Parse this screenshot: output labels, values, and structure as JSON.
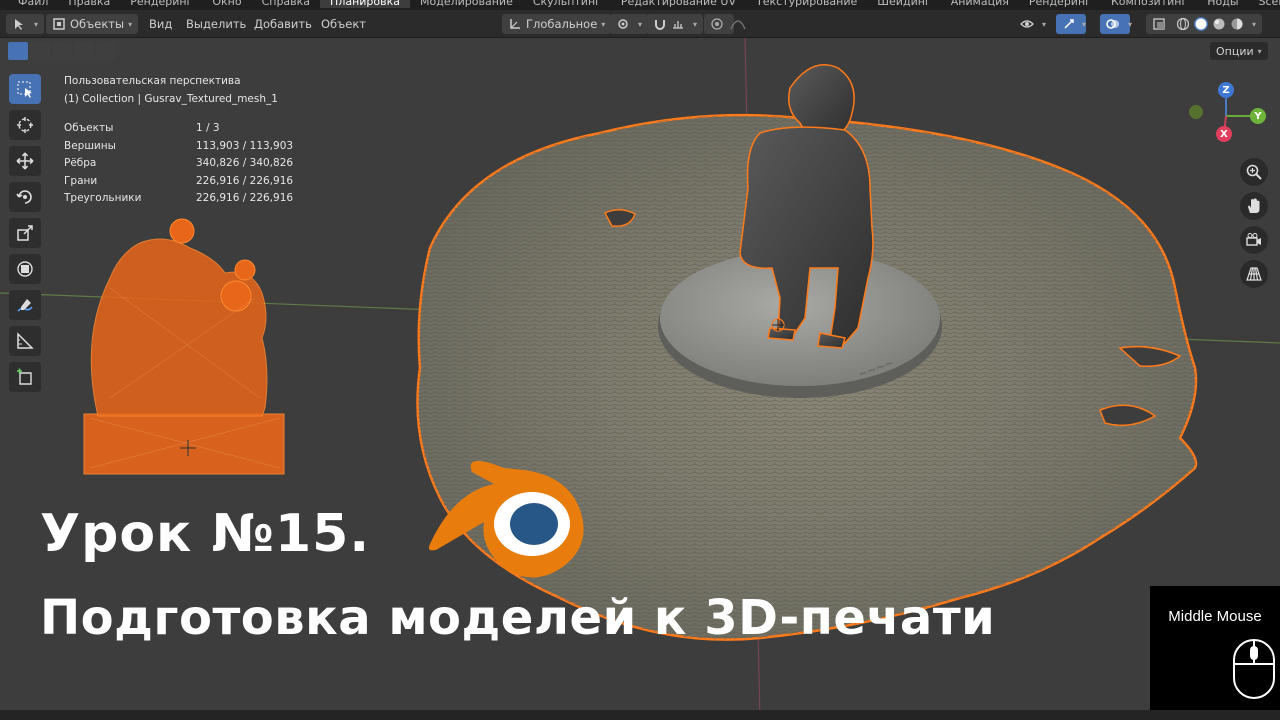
{
  "menu": {
    "items": [
      "Файл",
      "Правка",
      "Рендеринг",
      "Окно",
      "Справка",
      "Планировка",
      "Моделирование",
      "Скульптинг",
      "Редактирование UV",
      "Текстурирование",
      "Шейдинг",
      "Анимация",
      "Рендеринг",
      "Композитинг",
      "Ноды",
      "Scene"
    ],
    "active_index": 5
  },
  "toolbar": {
    "mode": "Объекты",
    "view": "Вид",
    "select": "Выделить",
    "add": "Добавить",
    "object": "Объект",
    "orientation": "Глобальное"
  },
  "viewport": {
    "options": "Опции",
    "perspective": "Пользовательская перспектива",
    "collection": "(1) Collection | Gusrav_Textured_mesh_1",
    "stats": [
      {
        "label": "Объекты",
        "value": "1 / 3"
      },
      {
        "label": "Вершины",
        "value": "113,903 / 113,903"
      },
      {
        "label": "Рёбра",
        "value": "340,826 / 340,826"
      },
      {
        "label": "Грани",
        "value": "226,916 / 226,916"
      },
      {
        "label": "Треугольники",
        "value": "226,916 / 226,916"
      }
    ],
    "gizmo": {
      "x": "X",
      "y": "Y",
      "z": "Z"
    }
  },
  "overlay": {
    "lesson": "Урок №15.",
    "subtitle": "Подготовка моделей к 3D-печати",
    "key_hint": "Middle Mouse"
  },
  "colors": {
    "blender_orange": "#e87d0d",
    "blender_blue": "#265787",
    "selection_orange": "#ff7a1a",
    "active_blue": "#4772b3"
  }
}
